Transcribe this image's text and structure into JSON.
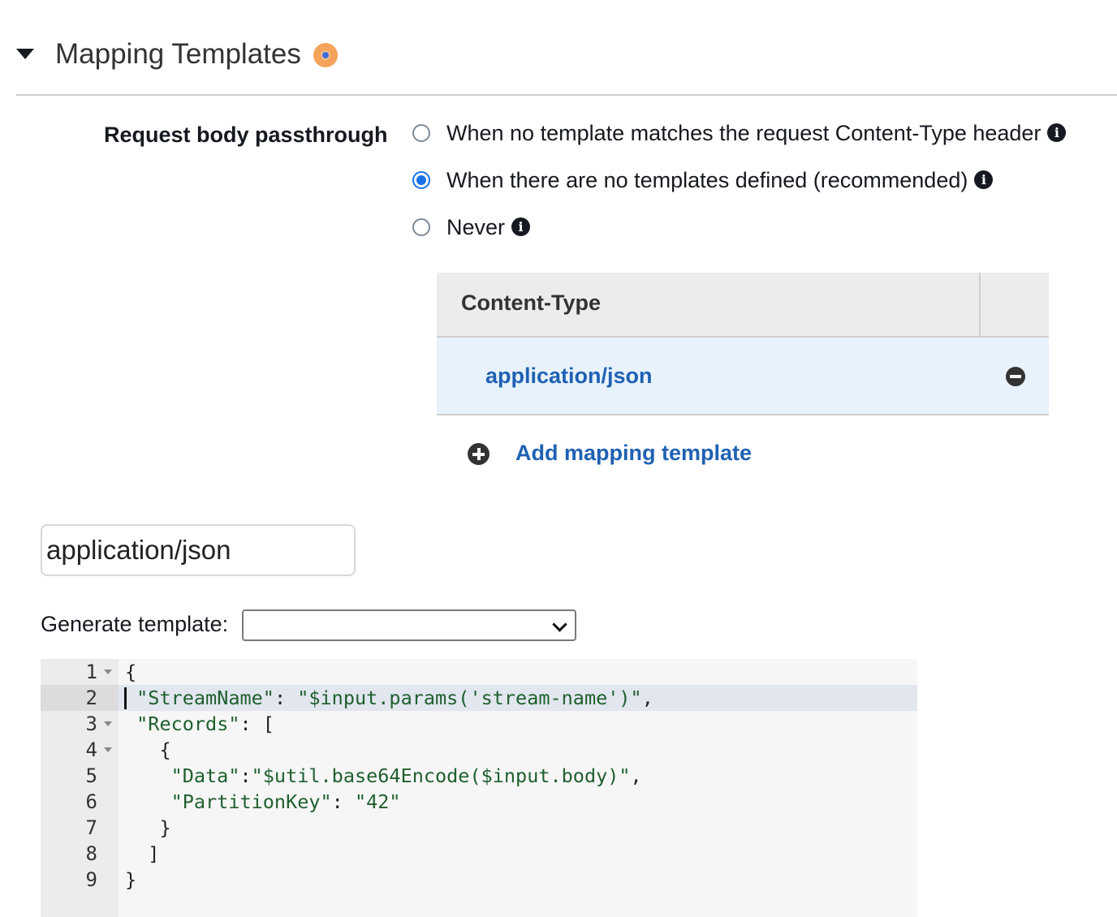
{
  "section": {
    "title": "Mapping Templates"
  },
  "passthrough": {
    "label": "Request body passthrough",
    "options": [
      {
        "label": "When no template matches the request Content-Type header",
        "checked": false
      },
      {
        "label": "When there are no templates defined (recommended)",
        "checked": true
      },
      {
        "label": "Never",
        "checked": false
      }
    ]
  },
  "content_type_table": {
    "header": "Content-Type",
    "rows": [
      "application/json"
    ]
  },
  "add_template": {
    "label": "Add mapping template"
  },
  "template_input": {
    "value": "application/json"
  },
  "generate_template": {
    "label": "Generate template:",
    "selected": ""
  },
  "editor": {
    "lines": [
      {
        "num": "1",
        "text": "{"
      },
      {
        "num": "2",
        "text": " \"StreamName\": \"$input.params('stream-name')\","
      },
      {
        "num": "3",
        "text": " \"Records\": ["
      },
      {
        "num": "4",
        "text": "   {"
      },
      {
        "num": "5",
        "text": "    \"Data\":\"$util.base64Encode($input.body)\","
      },
      {
        "num": "6",
        "text": "    \"PartitionKey\": \"42\""
      },
      {
        "num": "7",
        "text": "   }"
      },
      {
        "num": "8",
        "text": "  ]"
      },
      {
        "num": "9",
        "text": "}"
      }
    ]
  },
  "colors": {
    "link": "#1f61b3",
    "radio_checked": "#1a73e8",
    "selected_row_bg": "#e7f2fc",
    "code_string": "#1f5f2e"
  }
}
